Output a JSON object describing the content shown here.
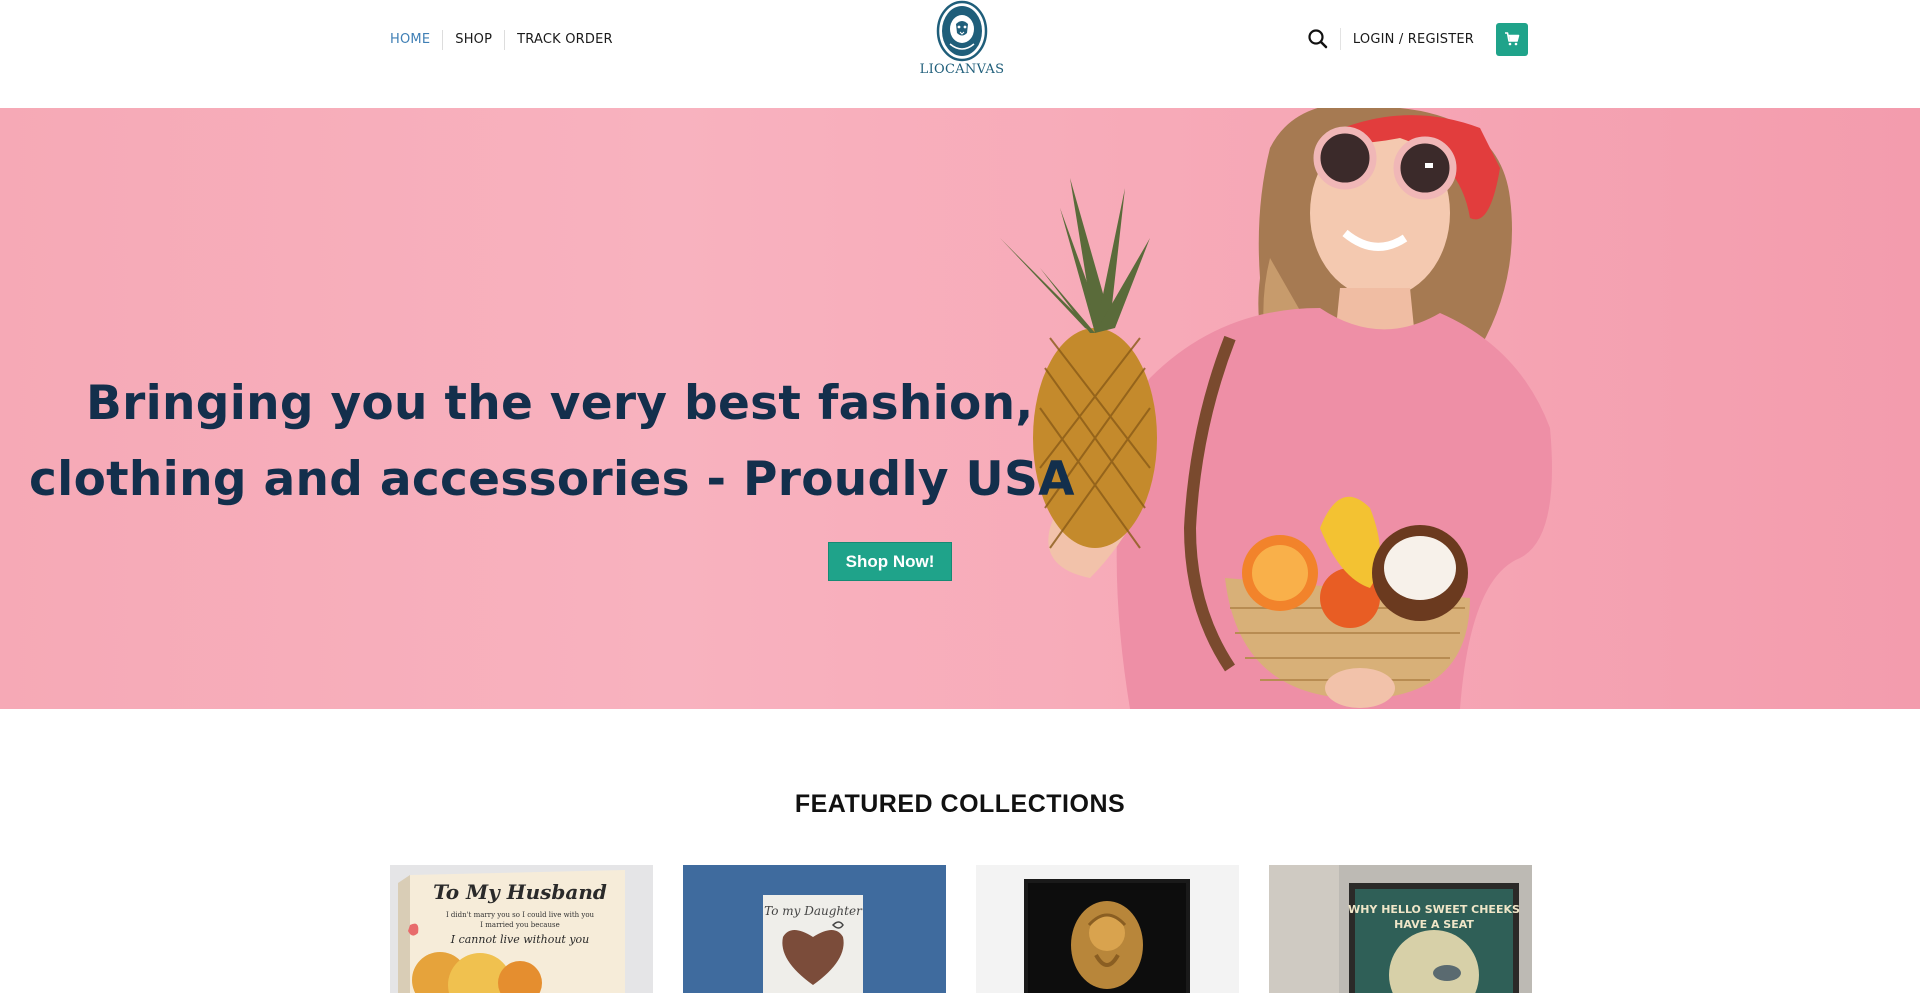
{
  "header": {
    "nav": [
      {
        "label": "HOME",
        "active": true
      },
      {
        "label": "SHOP",
        "active": false
      },
      {
        "label": "TRACK ORDER",
        "active": false
      }
    ],
    "logo_text": "LIOCANVAS",
    "login_label": "LOGIN / REGISTER",
    "icons": {
      "search": "search-icon",
      "cart": "cart-icon"
    }
  },
  "hero": {
    "line1": "Bringing you the very best fashion,",
    "line2": "clothing and accessories - Proudly USA",
    "button_label": "Shop Now!"
  },
  "featured": {
    "title": "FEATURED COLLECTIONS",
    "cards": [
      {
        "title": "To My Husband",
        "subtitle": "I didn't marry you so I could live with you",
        "subtitle2": "I married you because",
        "tagline": "I cannot live without you"
      },
      {
        "title": "To my Daughter"
      },
      {
        "title": ""
      },
      {
        "title": "WHY HELLO SWEET CHEEKS",
        "subtitle": "HAVE A SEAT"
      }
    ]
  },
  "colors": {
    "accent": "#1fa38a",
    "nav_active": "#3f7fb5",
    "hero_text": "#132f4c",
    "hero_bg": "#f7aab8",
    "logo": "#1f5e7a"
  }
}
